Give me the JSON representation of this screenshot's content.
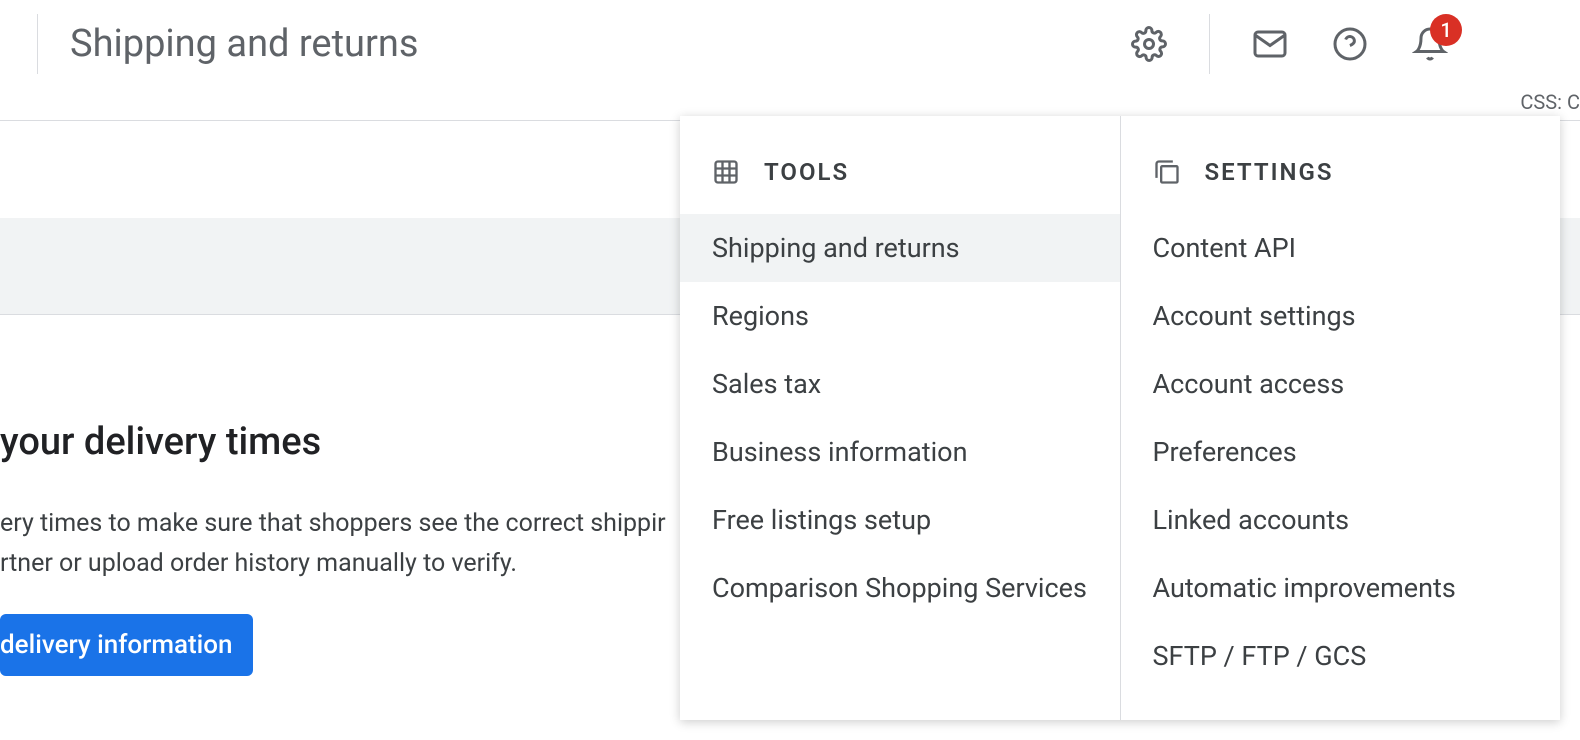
{
  "header": {
    "title": "Shipping and returns",
    "notification_count": "1",
    "css_label": "CSS: C"
  },
  "content": {
    "heading": " your delivery times",
    "body_line1": "ery times to make sure that shoppers see the correct shippir",
    "body_line2": "rtner or upload order history manually to verify.",
    "button_label": "delivery information"
  },
  "dropdown": {
    "tools": {
      "header": "TOOLS",
      "items": [
        "Shipping and returns",
        "Regions",
        "Sales tax",
        "Business information",
        "Free listings setup",
        "Comparison Shopping Services"
      ]
    },
    "settings": {
      "header": "SETTINGS",
      "items": [
        "Content API",
        "Account settings",
        "Account access",
        "Preferences",
        "Linked accounts",
        "Automatic improvements",
        "SFTP / FTP / GCS"
      ]
    }
  }
}
